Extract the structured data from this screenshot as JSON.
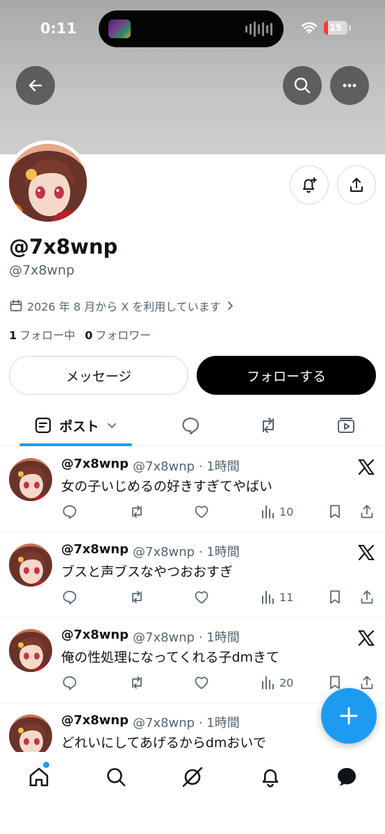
{
  "status_bar": {
    "time": "0:11",
    "battery": "15"
  },
  "header": {
    "back_icon": "arrow-left-icon",
    "search_icon": "search-icon",
    "more_icon": "more-horizontal-icon"
  },
  "profile": {
    "display_name": "@7x8wnp",
    "handle": "@7x8wnp",
    "joined": "2026 年 8 月から X を利用しています",
    "following_count": "1",
    "following_label": "フォロー中",
    "followers_count": "0",
    "followers_label": "フォロワー",
    "message_button": "メッセージ",
    "follow_button": "フォローする"
  },
  "tabs": {
    "posts_label": "ポスト"
  },
  "posts": [
    {
      "name": "@7x8wnp",
      "meta": "@7x8wnp · 1時間",
      "text": "女の子いじめるの好きすぎてやばい",
      "views": "10"
    },
    {
      "name": "@7x8wnp",
      "meta": "@7x8wnp · 1時間",
      "text": "ブスと声ブスなやつおおすぎ",
      "views": "11"
    },
    {
      "name": "@7x8wnp",
      "meta": "@7x8wnp · 1時間",
      "text": "俺の性処理になってくれる子dmきて",
      "views": "20"
    },
    {
      "name": "@7x8wnp",
      "meta": "@7x8wnp · 1時間",
      "text": "どれいにしてあげるからdmおいで",
      "views": ""
    }
  ],
  "colors": {
    "accent": "#1d9bf0",
    "text": "#0f1419",
    "muted": "#536471",
    "border": "#cfd9de"
  }
}
